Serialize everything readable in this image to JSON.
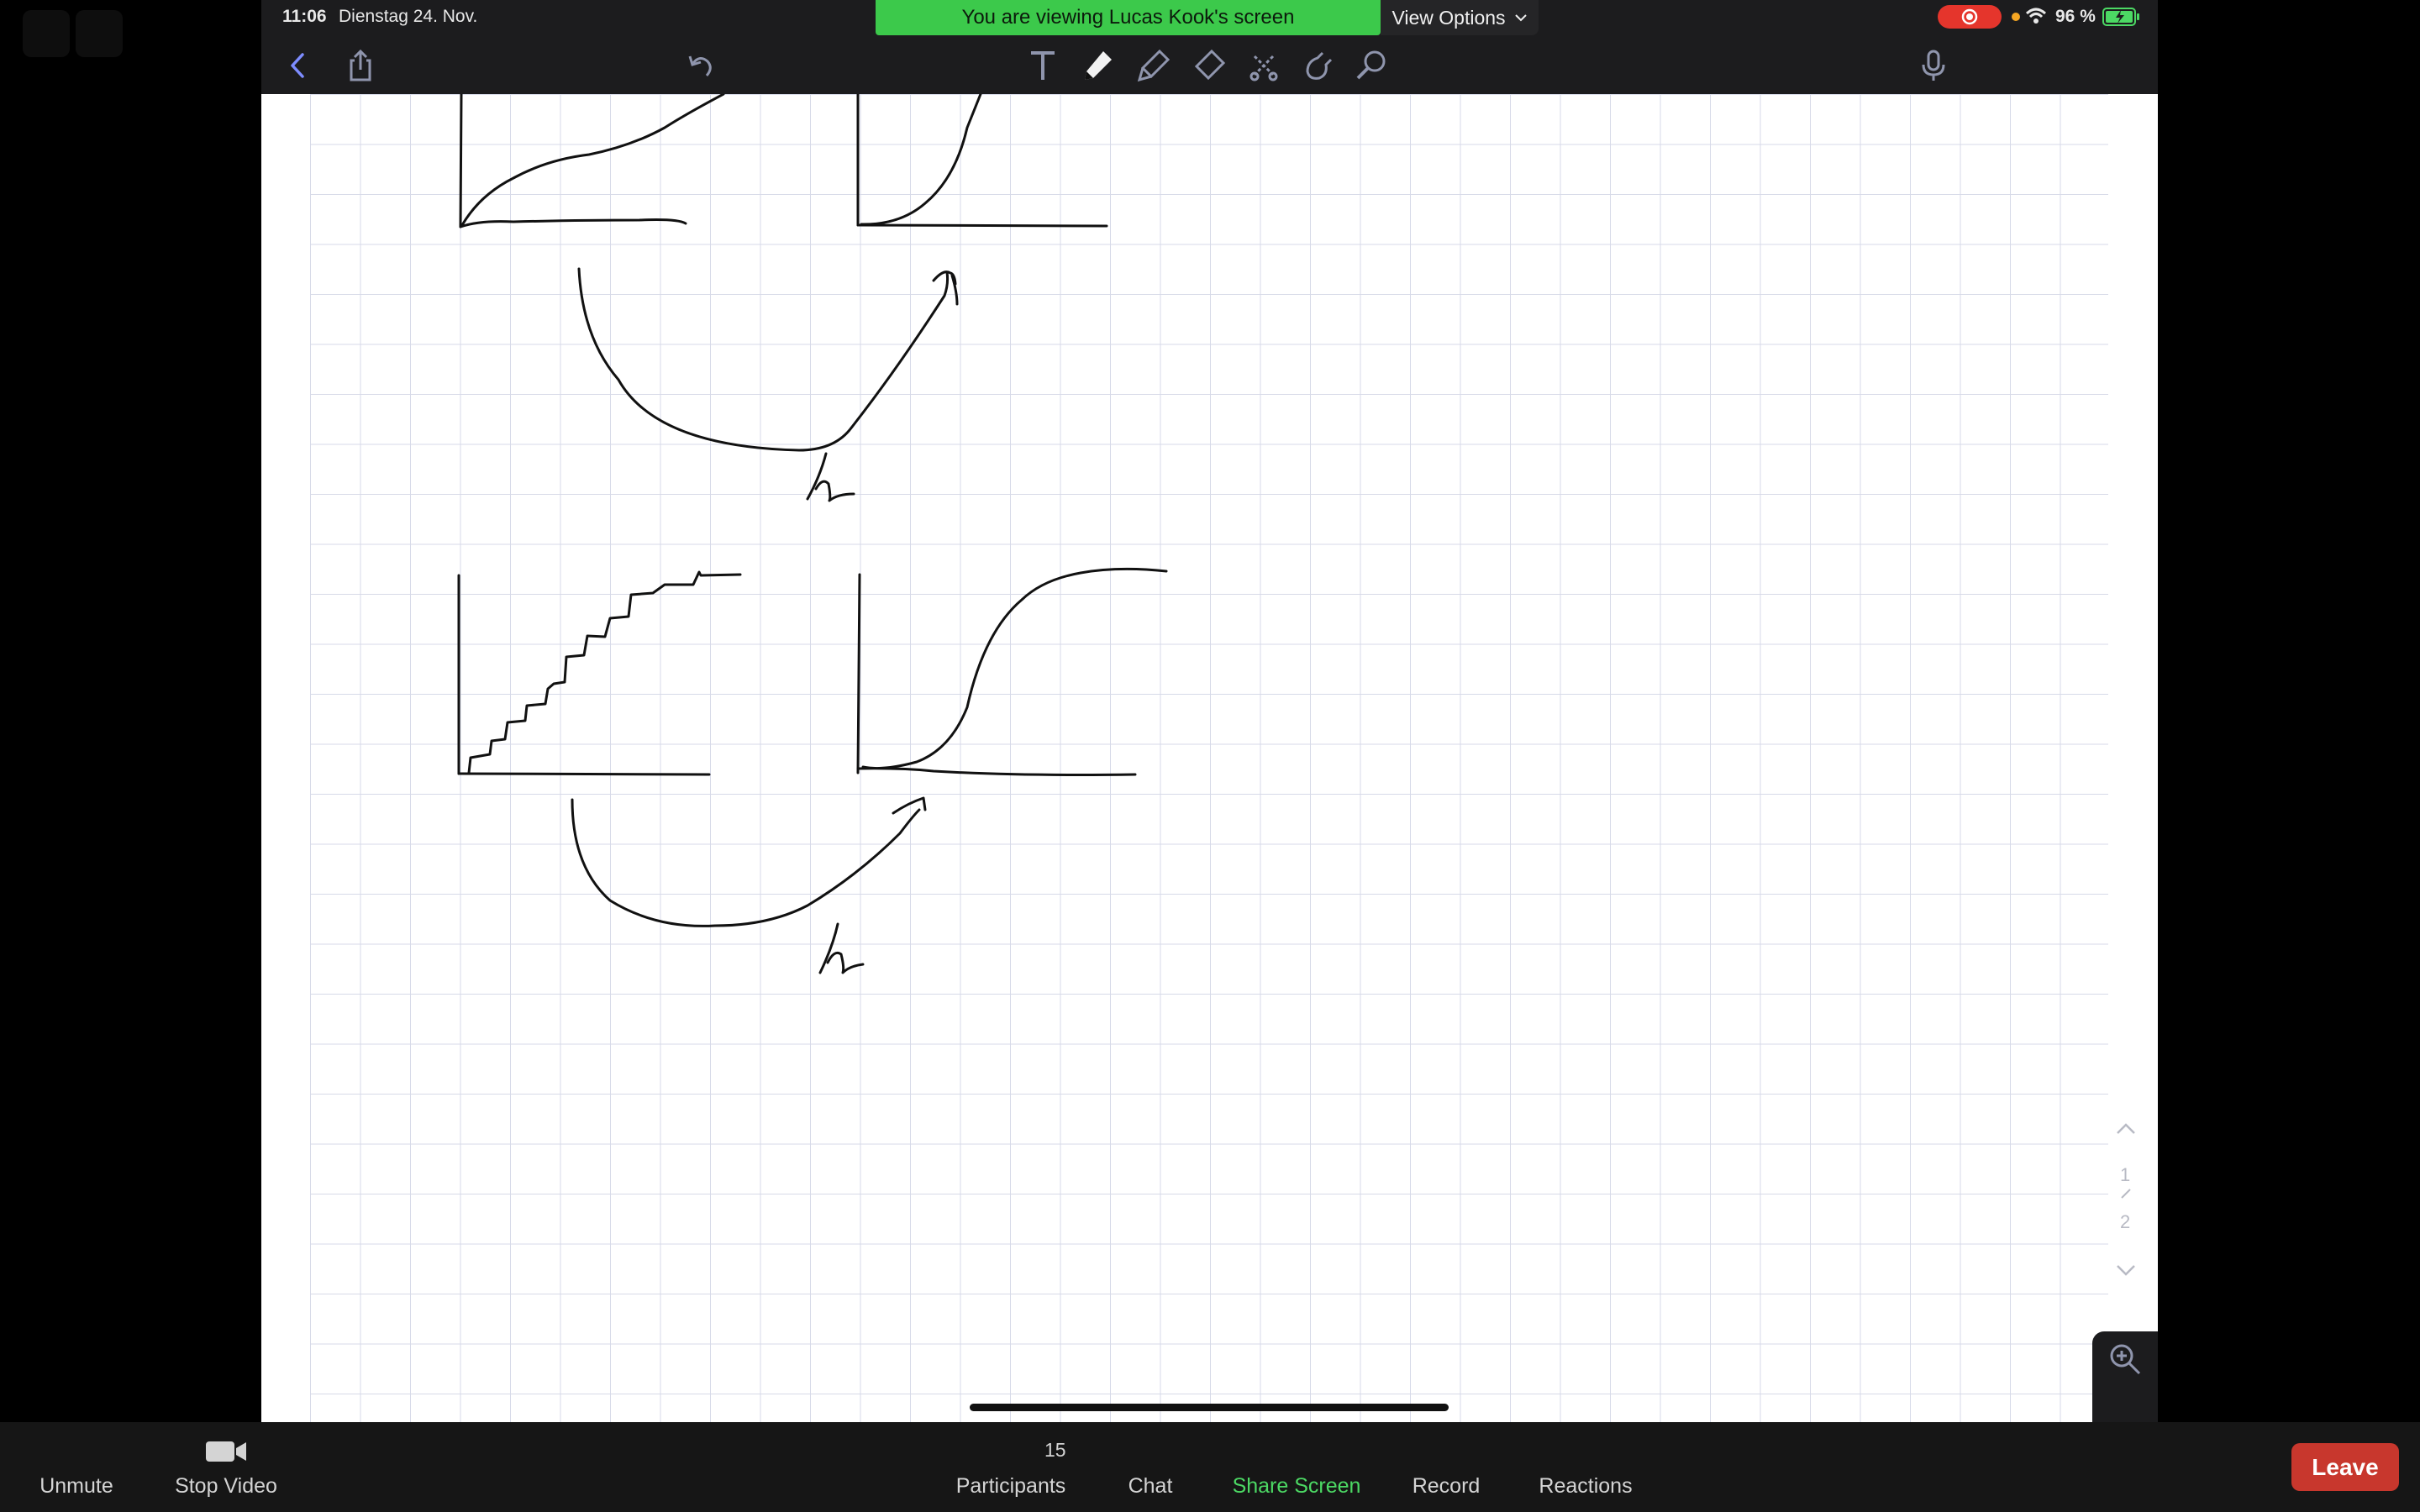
{
  "status_bar": {
    "time": "11:06",
    "date": "Dienstag 24. Nov.",
    "battery_percent": "96 %"
  },
  "banner": {
    "viewing_text": "You are viewing Lucas Kook's screen",
    "view_options_label": "View Options"
  },
  "page_nav": {
    "page_1": "1",
    "page_2": "2"
  },
  "zoom_bar": {
    "unmute_label": "Unmute",
    "stop_video_label": "Stop Video",
    "participants_count": "15",
    "participants_label": "Participants",
    "chat_label": "Chat",
    "share_screen_label": "Share Screen",
    "record_label": "Record",
    "reactions_label": "Reactions",
    "leave_label": "Leave"
  },
  "colors": {
    "banner_green": "#3cc94b",
    "share_screen_green": "#4cd964",
    "leave_red": "#c8372d",
    "record_indicator_red": "#e5352c",
    "battery_green": "#4cd964"
  },
  "icons": [
    "back-chevron-icon",
    "share-icon",
    "undo-icon",
    "text-tool-icon",
    "pen-tool-icon",
    "highlighter-tool-icon",
    "eraser-tool-icon",
    "lasso-tool-icon",
    "shapes-tool-icon",
    "laser-pointer-icon",
    "microphone-icon",
    "add-page-icon",
    "more-icon",
    "page-layout-icon",
    "zoom-icon",
    "chevron-up-icon",
    "chevron-down-icon",
    "video-camera-icon"
  ]
}
